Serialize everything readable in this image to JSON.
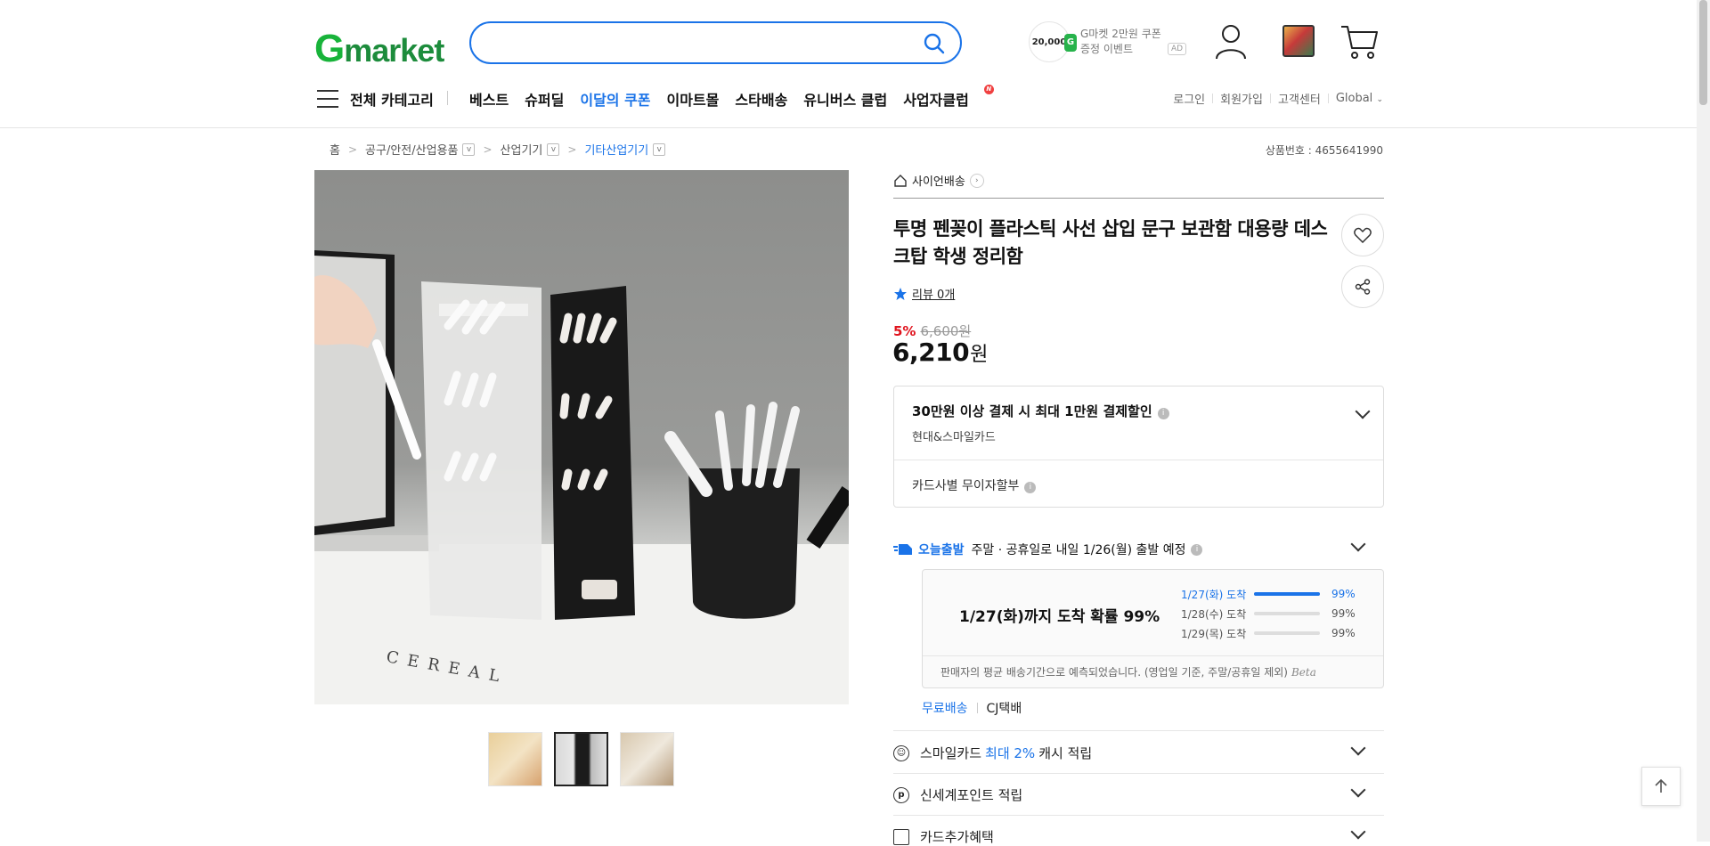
{
  "header": {
    "logo_g": "G",
    "logo_rest": "market",
    "search": {
      "value": "",
      "placeholder": ""
    },
    "promo": {
      "coin_amount": "20,000",
      "coin_g": "G",
      "line1": "G마켓 2만원 쿠폰",
      "line2": "증정 이벤트",
      "ad_label": "AD"
    }
  },
  "nav": {
    "all_categories": "전체 카테고리",
    "items": [
      {
        "label": "베스트"
      },
      {
        "label": "슈퍼딜"
      },
      {
        "label": "이달의 쿠폰"
      },
      {
        "label": "이마트몰"
      },
      {
        "label": "스타배송"
      },
      {
        "label": "유니버스 클럽"
      },
      {
        "label": "사업자클럽",
        "badge": "N"
      }
    ],
    "util": [
      "로그인",
      "회원가입",
      "고객센터",
      "Global"
    ]
  },
  "breadcrumb": {
    "items": [
      "홈",
      "공구/안전/산업용품",
      "산업기기",
      "기타산업기기"
    ],
    "dropdown_icon": "v",
    "arrow": ">"
  },
  "product_number": "상품번호 : 4655641990",
  "product": {
    "seller": "사이언배송",
    "title": "투명 펜꽂이 플라스틱 사선 삽입 문구 보관함 대용량 데스크탑 학생 정리함",
    "review_text": "리뷰 0개",
    "discount_rate": "5%",
    "original_price": "6,600원",
    "price": "6,210",
    "price_unit": "원",
    "main_image_text": "CEREAL"
  },
  "card_benefit": {
    "title": "30만원 이상 결제 시 최대 1만원 결제할인",
    "sub": "현대&스마일카드",
    "installment": "카드사별 무이자할부",
    "info": "i"
  },
  "shipping": {
    "brand": "오늘출발",
    "text": "주말 · 공휴일로 내일 1/26(월) 출발 예정",
    "summary": "1/27(화)까지 도착 확률 99%",
    "probabilities": [
      {
        "date": "1/27(화) 도착",
        "pct": "99%",
        "fill": 1.0
      },
      {
        "date": "1/28(수) 도착",
        "pct": "99%",
        "fill": 0.0
      },
      {
        "date": "1/29(목) 도착",
        "pct": "99%",
        "fill": 0.0
      }
    ],
    "note": "판매자의 평균 배송기간으로 예측되었습니다. (영업일 기준, 주말/공휴일 제외)",
    "beta": "Beta",
    "free": "무료배송",
    "carrier": "CJ택배"
  },
  "benefits": [
    {
      "pre": "스마일카드",
      "highlight": "최대 2%",
      "post": "캐시 적립",
      "icon": "smile-icon"
    },
    {
      "pre": "신세계포인트 적립",
      "highlight": "",
      "post": "",
      "icon": "p"
    },
    {
      "pre": "카드추가혜택",
      "highlight": "",
      "post": "",
      "icon": "card-icon"
    }
  ],
  "colors": {
    "accent": "#1a73e8",
    "brand_green": "#18b33a",
    "discount": "#e0141e"
  }
}
